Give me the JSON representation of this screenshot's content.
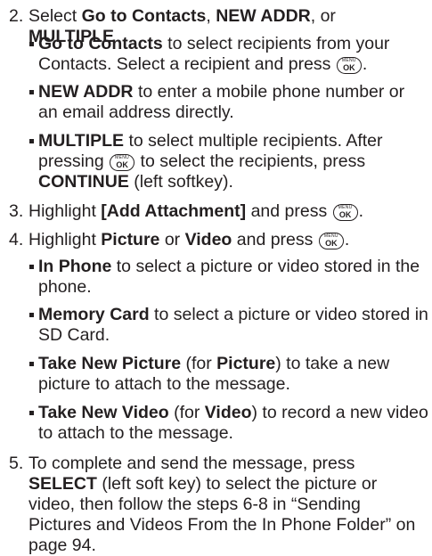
{
  "step2": {
    "num": "2.",
    "t1": "Select ",
    "b1": "Go to Contacts",
    "t2": ", ",
    "b2": "NEW ADDR",
    "t3": ", or ",
    "b3": "MULTIPLE"
  },
  "bullet_contacts": {
    "b": "Go to Contacts",
    "t1": " to select recipients from your Contacts. Select a recipient and press ",
    "t2": "."
  },
  "bullet_newaddr": {
    "b": "NEW ADDR",
    "t": " to enter a mobile phone number or an email address directly."
  },
  "bullet_multiple": {
    "b": "MULTIPLE",
    "t1": " to select multiple recipients. After pressing ",
    "t2": " to select the recipients, press ",
    "b2": "CONTINUE",
    "t3": " (left softkey)."
  },
  "step3": {
    "num": "3.",
    "t1": "Highlight ",
    "b1": "[Add Attachment]",
    "t2": " and press ",
    "t3": "."
  },
  "step4": {
    "num": "4.",
    "t1": "Highlight ",
    "b1": "Picture",
    "t2": " or ",
    "b2": "Video",
    "t3": " and press ",
    "t4": "."
  },
  "bullet_inphone": {
    "b": "In Phone",
    "t": " to select a picture or video stored in the phone."
  },
  "bullet_memory": {
    "b": "Memory Card",
    "t": "  to select a picture or video stored in SD Card."
  },
  "bullet_takepic": {
    "b": "Take New Picture",
    "t1": " (for ",
    "b2": "Picture",
    "t2": ") to take a new picture to attach to the message."
  },
  "bullet_takevid": {
    "b": "Take New Video",
    "t1": " (for ",
    "b2": "Video",
    "t2": ") to record a new video to attach to the message."
  },
  "step5": {
    "num": "5.",
    "t1": "To complete and send the message, press ",
    "b1": "SELECT",
    "t2": " (left soft key) to select the picture or video, then follow the steps 6-8 in “Sending Pictures and Videos From the In Phone Folder” on page 94."
  },
  "key": {
    "top": "MENU",
    "label": "OK"
  },
  "icons": {
    "bullet": "square-bullet",
    "key": "menu-ok-key-icon"
  }
}
